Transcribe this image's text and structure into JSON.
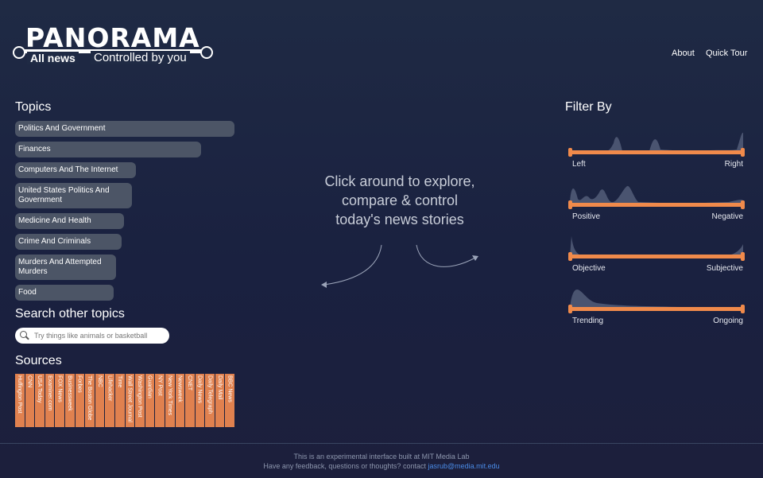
{
  "header": {
    "logo_main": "PANORAMA",
    "logo_sub_left": "All news",
    "logo_sub_right": "Controlled by you",
    "nav": [
      "About",
      "Quick Tour"
    ]
  },
  "topics": {
    "title": "Topics",
    "items": [
      "Politics And Government",
      "Finances",
      "Computers And The Internet",
      "United States Politics And Government",
      "Medicine And Health",
      "Crime And Criminals",
      "Murders And Attempted Murders",
      "Food"
    ]
  },
  "search": {
    "title": "Search other topics",
    "placeholder": "Try things like animals or basketball"
  },
  "sources": {
    "title": "Sources",
    "items": [
      "Huffington Post",
      "CNN",
      "USA Today",
      "Examiner.com",
      "FOX News",
      "Businessweek",
      "Forbes",
      "The Boston Globe",
      "NBC",
      "Lifehacker",
      "Time",
      "Wall Street Journal",
      "Washington Post",
      "Guardian",
      "NY Post",
      "New York Times",
      "Newsweek",
      "CNET",
      "Daily News",
      "Daily Telegraph",
      "Daily Mail",
      "BBC News"
    ]
  },
  "center_prompt": [
    "Click around to explore,",
    "compare & control",
    "today's news stories"
  ],
  "filters": {
    "title": "Filter By",
    "items": [
      {
        "left": "Left",
        "right": "Right"
      },
      {
        "left": "Positive",
        "right": "Negative"
      },
      {
        "left": "Objective",
        "right": "Subjective"
      },
      {
        "left": "Trending",
        "right": "Ongoing"
      }
    ]
  },
  "footer": {
    "line1": "This is an experimental interface built at MIT Media Lab",
    "line2_prefix": "Have any feedback, questions or thoughts? contact ",
    "email": "jasrub@media.mit.edu"
  },
  "colors": {
    "accent": "#f08a4b",
    "source_bar": "#e0814f",
    "topic_pill": "#4c5566",
    "link": "#4a8be6"
  }
}
